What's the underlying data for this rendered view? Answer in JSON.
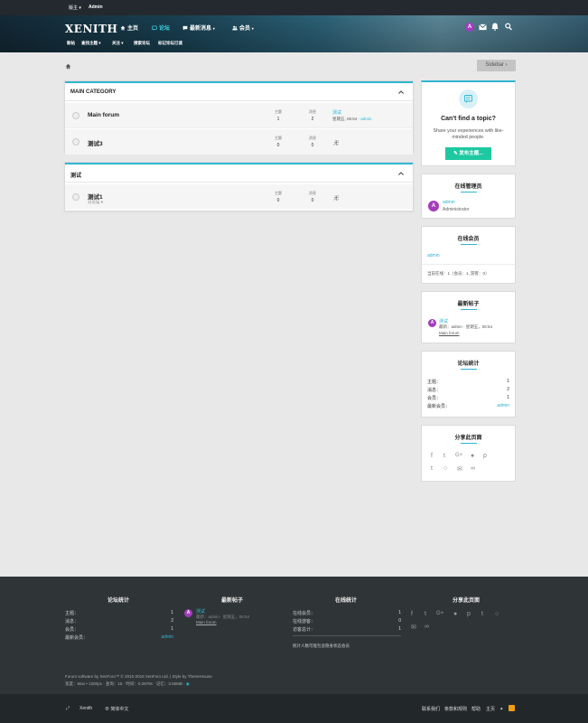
{
  "topbar": {
    "left1": "版主",
    "left2": "Admin"
  },
  "header": {
    "logo": "XENITH",
    "nav": [
      {
        "label": "主页"
      },
      {
        "label": "论坛"
      },
      {
        "label": "最新消息"
      },
      {
        "label": "会员"
      }
    ],
    "subnav": [
      "新帖",
      "查找主题",
      "关注",
      "搜索论坛",
      "标记论坛已读"
    ],
    "avatar_letter": "A"
  },
  "sidebar_button": "Sidebar",
  "categories": [
    {
      "title": "MAIN CATEGORY",
      "forums": [
        {
          "name": "Main forum",
          "threads_label": "主题",
          "threads": "1",
          "messages_label": "消息",
          "messages": "2",
          "last_title": "测试",
          "last_meta": "星期五, 06:54 · ",
          "last_user": "admin"
        },
        {
          "name": "测试3",
          "threads_label": "主题",
          "threads": "0",
          "messages_label": "消息",
          "messages": "0",
          "none": "无"
        }
      ]
    },
    {
      "title": "测试",
      "forums": [
        {
          "name": "测试1",
          "sub": "分论坛",
          "threads_label": "主题",
          "threads": "0",
          "messages_label": "消息",
          "messages": "0",
          "none": "无"
        }
      ]
    }
  ],
  "cant_find": {
    "title": "Can't find a topic?",
    "text1": "Share your experiences with like-",
    "text2": "minded people.",
    "button": "发布主题..."
  },
  "staff": {
    "title": "在线管理员",
    "name": "admin",
    "role": "Administrator"
  },
  "members": {
    "title": "在线会员",
    "name": "admin",
    "stats": "当前在线：1（会员：1, 游客：0）"
  },
  "latest": {
    "title": "最新帖子",
    "post_title": "测试",
    "post_meta": "最新：admin · 星期五，06:54",
    "post_forum": "Main forum"
  },
  "stats": {
    "title": "论坛统计",
    "rows": [
      {
        "k": "主题：",
        "v": "1"
      },
      {
        "k": "消息：",
        "v": "2"
      },
      {
        "k": "会员：",
        "v": "1"
      },
      {
        "k": "最新会员：",
        "v": "admin"
      }
    ]
  },
  "share": {
    "title": "分享此页面"
  },
  "footer": {
    "stats_title": "论坛统计",
    "stats": [
      {
        "k": "主题：",
        "v": "1"
      },
      {
        "k": "消息：",
        "v": "2"
      },
      {
        "k": "会员：",
        "v": "1"
      },
      {
        "k": "最新会员：",
        "v": "admin"
      }
    ],
    "latest_title": "最新帖子",
    "latest_post": "测试",
    "latest_meta": "最新：admin · 星期五，06:54",
    "latest_forum": "Main forum",
    "online_title": "在线统计",
    "online": [
      {
        "k": "在线会员：",
        "v": "1"
      },
      {
        "k": "在线游客：",
        "v": "0"
      },
      {
        "k": "访客总计：",
        "v": "1"
      }
    ],
    "online_note": "统计人数可能包含隐身状态会员",
    "share_title": "分享此页面",
    "copyright": "Forum software by XenForo™ © 2010-2018 XenForo Ltd. | Style by ThemeHouse",
    "debug": "宽度：Max • 1200px · 查询：15 · 时间：0.2878s · 记忆：3.55MB · "
  },
  "bottom": {
    "style": "Xenith",
    "lang": "简体中文",
    "links": [
      "联系我们",
      "条款和规则",
      "帮助",
      "主页"
    ]
  },
  "colors": {
    "accent": "#2fb5d2",
    "button": "#1ec9a1",
    "avatar": "#a33bbd"
  }
}
